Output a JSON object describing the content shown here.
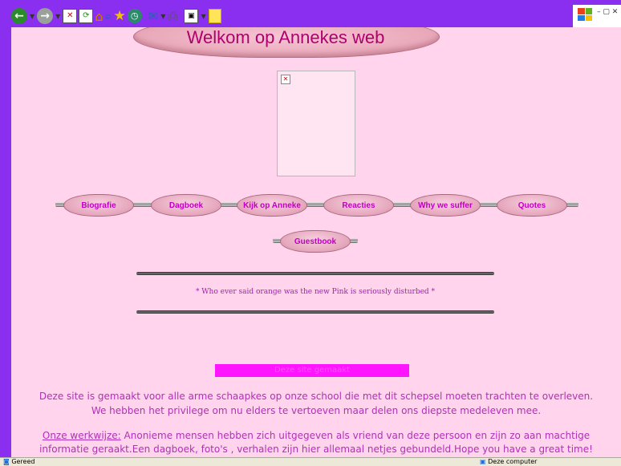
{
  "toolbar": {
    "buttons": [
      "back-icon",
      "forward-icon",
      "stop-icon",
      "refresh-icon",
      "home-icon",
      "search-icon",
      "favorites-icon",
      "history-icon",
      "mail-icon",
      "print-icon",
      "edit-icon",
      "messenger-icon"
    ]
  },
  "header": {
    "title": "Welkom op Annekes web"
  },
  "nav": {
    "row1": [
      "Biografie",
      "Dagboek",
      "Kijk op Anneke",
      "Reacties",
      "Why we suffer",
      "Quotes"
    ],
    "row2": [
      "Guestbook"
    ]
  },
  "quote": "* Who ever said orange was the new Pink is seriously disturbed *",
  "magenta_bar": {
    "text": "Deze site gemaakt"
  },
  "intro": {
    "line1": "Deze site is gemaakt voor alle arme schaapkes op onze school die met dit schepsel moeten trachten te overleven.",
    "line2": "We hebben het privilege om nu elders te vertoeven maar delen ons diepste medeleven mee."
  },
  "method": {
    "label": "Onze werkwijze:",
    "text1": " Anonieme mensen hebben zich uitgegeven als vriend van deze persoon en zijn zo aan machtige",
    "text2": "informatie geraakt.Een dagboek, foto's , verhalen zijn hier allemaal netjes gebundeld.Hope you have a great time!"
  },
  "statusbar": {
    "left": "Gereed",
    "right": "Deze computer"
  },
  "colors": {
    "page_bg": "#ffd4ec",
    "frame": "#8a2ff0",
    "accent": "#c000c0",
    "bar": "#ff14ff"
  }
}
